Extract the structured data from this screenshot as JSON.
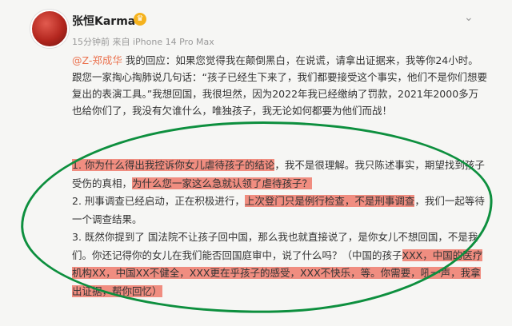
{
  "post": {
    "username": "张恒Karma",
    "badge_icon": "crown-icon",
    "meta": "15分钟前 来自 iPhone 14 Pro Max",
    "mention": "@Z-郑成华",
    "para_after_mention": " 我的回应：如果您觉得我在颠倒黑白，在说谎，请拿出证据来，我等你24小时。跟您一家掏心掏肺说几句话：“孩子已经生下来了，我们都要接受这个事实，他们不是你们想要复出的表演工具。”我想回国，我很坦然，因为2022年我已经缴纳了罚款，2021年2000多万也给你们了，我没有欠谁什么，唯独孩子，我无论如何都要为他们而战！",
    "item1_hl1": "1. 你为什么得出我控诉你女儿虐待孩子的结论",
    "item1_plain": "，我不是很理解。我只陈述事实，期望找到孩子受伤的真相，",
    "item1_hl2": "为什么您一家这么急就认领了虐待孩子？",
    "item2_plain1": "2. 刑事调查已经启动，正在积极进行，",
    "item2_hl": "上次登门只是例行检查，不是刑事调查",
    "item2_plain2": "，我们一起等待一个调查结果。",
    "item3_plain": "3. 既然你提到了 国法院不让孩子回中国，那么我也就直接说了，是你女儿不想回国，不是我们。你还记得你的女儿在我们能否回国庭审中，说了什么吗？（中国的孩子",
    "item3_hl": "XXX，中国的医疗机构XX，中国XX不健全，XXX更在乎孩子的感受，XXX不快乐，等。你需要，吼一声，我拿出证据，帮你回忆）"
  },
  "colors": {
    "highlight": "#f08d80",
    "circle": "#0d8f3e",
    "mention": "#eb7350"
  }
}
